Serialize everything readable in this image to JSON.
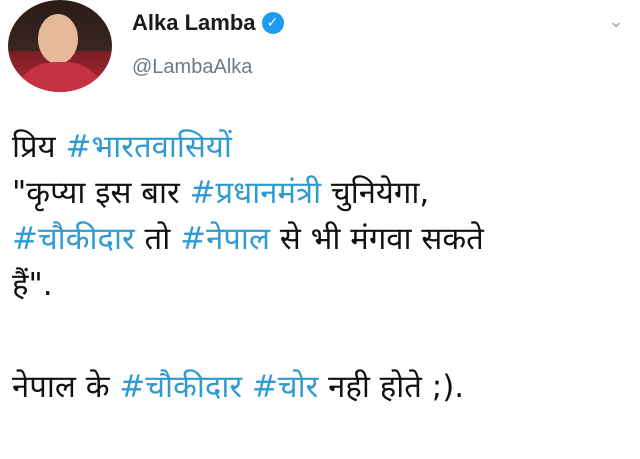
{
  "tweet": {
    "display_name": "Alka Lamba",
    "verified_icon": "verified-badge-icon",
    "handle": "@LambaAlka",
    "menu_icon": "chevron-down-icon",
    "colors": {
      "hashtag": "#2f9bd1",
      "verified": "#1d9bf0",
      "handle": "#6e7a84"
    },
    "lines": [
      [
        {
          "t": "प्रिय "
        },
        {
          "t": "#भारतवासियों",
          "tag": true
        }
      ],
      [
        {
          "t": "\"कृप्या इस बार "
        },
        {
          "t": "#प्रधानमंत्री",
          "tag": true
        },
        {
          "t": " चुनियेगा,"
        }
      ],
      [
        {
          "t": "#चौकीदार",
          "tag": true
        },
        {
          "t": " तो "
        },
        {
          "t": "#नेपाल",
          "tag": true
        },
        {
          "t": " से भी मंगवा सकते"
        }
      ],
      [
        {
          "t": "हैं\"."
        }
      ],
      [],
      [
        {
          "t": "नेपाल के "
        },
        {
          "t": "#चौकीदार",
          "tag": true
        },
        {
          "t": " "
        },
        {
          "t": "#चोर",
          "tag": true
        },
        {
          "t": " नही होते ;)."
        }
      ]
    ]
  }
}
